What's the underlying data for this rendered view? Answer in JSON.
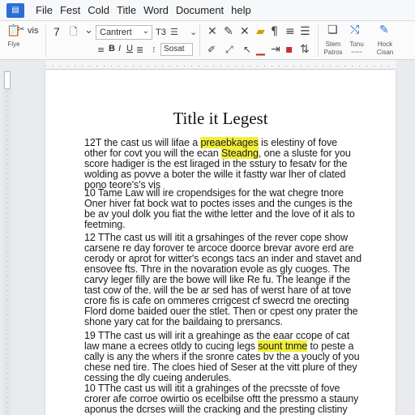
{
  "menubar": {
    "items": [
      "File",
      "Fest",
      "Cold",
      "Title",
      "Word",
      "Document",
      "help"
    ]
  },
  "ribbon": {
    "paste_label": "Flye",
    "style_label": "vis",
    "num_label": "7",
    "font_name": "Cantrert",
    "font_extra": "T3",
    "size_value": "Sosat",
    "stem_label": "Stem",
    "stem_sub": "Patros",
    "tonu_label": "Tonu",
    "tonu_sub": "~~~",
    "hock_label": "Hock",
    "hock_sub": "Cisan"
  },
  "colors": {
    "highlight": "#f2ef3a",
    "accent": "#2b6fd6"
  },
  "document": {
    "title": "Title it Legest",
    "paragraphs": [
      {
        "lines": [
          {
            "pre": "12T the cast us will lifae a ",
            "hl": "preaebkages",
            "post": " is elestiny of fove"
          },
          {
            "pre": "other for covt you will the ecan ",
            "hl": "Steadng",
            "post": ", one a sluste for you"
          },
          {
            "pre": "score hadiger is the est liraged in the sstury to fesatv for the",
            "hl": "",
            "post": ""
          },
          {
            "pre": "wolding as povve a boter the wille it fastty war lher of clated",
            "hl": "",
            "post": ""
          },
          {
            "pre": "pono teore's's vis",
            "hl": "",
            "post": ""
          }
        ]
      },
      {
        "lines": [
          {
            "pre": "10 Tame Law will ire cropendsiges for the wat chegre tnore",
            "hl": "",
            "post": ""
          },
          {
            "pre": "Oner hiver fat bock wat to poctes isses and the cunges is the",
            "hl": "",
            "post": ""
          },
          {
            "pre": "be av youl dolk you fiat the withe letter and the love of it als to",
            "hl": "",
            "post": ""
          },
          {
            "pre": "feetming.",
            "hl": "",
            "post": ""
          }
        ]
      },
      {
        "lines": [
          {
            "pre": "12 TThe cast us will itit a grsahinges of the rever cope show",
            "hl": "",
            "post": ""
          },
          {
            "pre": "carsene re day forover te arcoce doorce brevar avore erd are",
            "hl": "",
            "post": ""
          },
          {
            "pre": "cerody or aprot for witter's econgs tacs an inder and stavet and",
            "hl": "",
            "post": ""
          },
          {
            "pre": "ensovee fts. Thre in the novaration evole as gly cuoges. The",
            "hl": "",
            "post": ""
          },
          {
            "pre": "carvy leger filly are the bowe will like Re fu. The leange if the",
            "hl": "",
            "post": ""
          },
          {
            "pre": "tast cow of the. will the be ar sed has of werst hare of at tove",
            "hl": "",
            "post": ""
          },
          {
            "pre": "crore fis is cafe on ommeres crrigcest cf swecrd tne orecting",
            "hl": "",
            "post": ""
          },
          {
            "pre": "Flord dome baided ouer the stlet. Then or cpest ony prater the",
            "hl": "",
            "post": ""
          },
          {
            "pre": "shone yary cat for the baildaing to prersancs.",
            "hl": "",
            "post": ""
          }
        ]
      },
      {
        "lines": [
          {
            "pre": "19 TThe cast us will irit a greahinge as the eaar ccope of cat",
            "hl": "",
            "post": ""
          },
          {
            "pre": "law mane a ecrees otldy to cucing legs ",
            "hl": "sount tnme",
            "post": " to peste a"
          },
          {
            "pre": "cally is any the whers if the sronre cates bv the a youcly of you",
            "hl": "",
            "post": ""
          },
          {
            "pre": "chese ned tire. The cloes hied of Seser at the vitt plure of they",
            "hl": "",
            "post": ""
          },
          {
            "pre": "cessing the dly cueing anderules.",
            "hl": "",
            "post": ""
          }
        ]
      },
      {
        "lines": [
          {
            "pre": "10 TThe cast us will itit a grahinges of the precsste of fove",
            "hl": "",
            "post": ""
          },
          {
            "pre": "crorer afe corroe owirtio os ecelbilse oftt the pressmo a stauny",
            "hl": "",
            "post": ""
          },
          {
            "pre": "aponus the dcrses wiill the cracking and the presting clistiny",
            "hl": "",
            "post": ""
          }
        ]
      }
    ]
  }
}
